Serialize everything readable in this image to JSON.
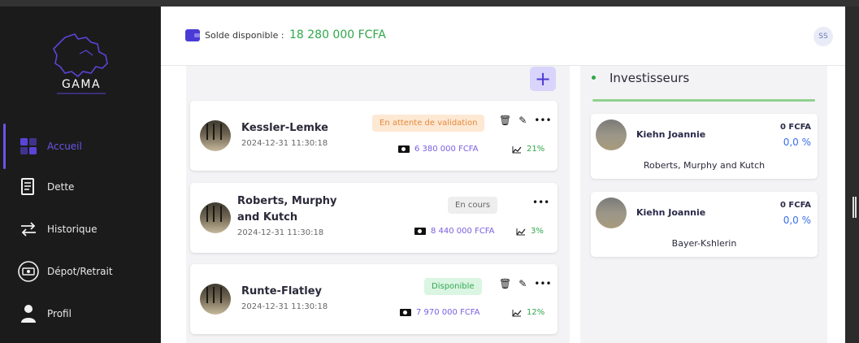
{
  "app": {
    "logo_text": "GAMA"
  },
  "sidebar": {
    "items": [
      {
        "label": "Accueil",
        "icon": "dashboard-icon",
        "active": true
      },
      {
        "label": "Dette",
        "icon": "receipt-icon"
      },
      {
        "label": "Historique",
        "icon": "swap-arrows-icon"
      },
      {
        "label": "Dépot/Retrait",
        "icon": "cash-icon"
      },
      {
        "label": "Profil",
        "icon": "user-icon"
      }
    ]
  },
  "header": {
    "balance_label": "Solde disponible :",
    "balance_value": "18 280 000 FCFA",
    "avatar_initials": "SS"
  },
  "projects": [
    {
      "name": "Kessler-Lemke",
      "date": "2024-12-31 11:30:18",
      "status": "En attente de validation",
      "amount": "6 380 000 FCFA",
      "percent": "21%"
    },
    {
      "name": "Roberts, Murphy and Kutch",
      "date": "2024-12-31 11:30:18",
      "status": "En cours",
      "amount": "8 440 000 FCFA",
      "percent": "3%"
    },
    {
      "name": "Runte-Flatley",
      "date": "2024-12-31 11:30:18",
      "status": "Disponible",
      "amount": "7 970 000 FCFA",
      "percent": "12%"
    }
  ],
  "investors": {
    "title": "Investisseurs",
    "items": [
      {
        "name": "Kiehn Joannie",
        "amount": "0 FCFA",
        "percent": "0,0 %",
        "company": "Roberts, Murphy and Kutch"
      },
      {
        "name": "Kiehn Joannie",
        "amount": "0 FCFA",
        "percent": "0,0 %",
        "company": "Bayer-Kshlerin"
      }
    ]
  },
  "colors": {
    "accent": "#6a55e8",
    "balance": "#2ea84a",
    "sidebar_bg": "#1b1b1b"
  }
}
